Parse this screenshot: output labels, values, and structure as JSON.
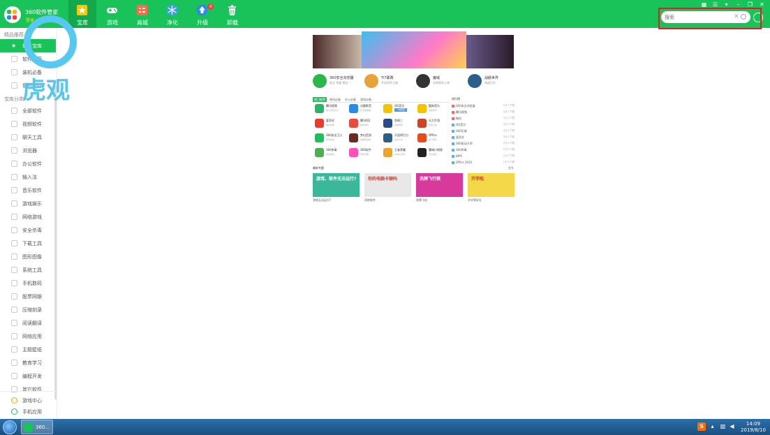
{
  "app": {
    "title": "360软件管家",
    "subtitle": "登录"
  },
  "nav": [
    {
      "label": "宝库",
      "icon": "star-icon"
    },
    {
      "label": "游戏",
      "icon": "gamepad-icon"
    },
    {
      "label": "商城",
      "icon": "store-icon"
    },
    {
      "label": "净化",
      "icon": "snowflake-icon"
    },
    {
      "label": "升级",
      "icon": "upgrade-icon",
      "badge": "4"
    },
    {
      "label": "卸载",
      "icon": "trash-icon"
    }
  ],
  "window_controls": {
    "skin": "▦",
    "menu": "☰",
    "dropdown": "▾",
    "minimize": "–",
    "restore": "❐",
    "close": "✕"
  },
  "search": {
    "placeholder": "搜索",
    "clear": "✕"
  },
  "sidebar": {
    "section_featured": "精品推荐",
    "featured_items": [
      {
        "label": "软件宝库"
      },
      {
        "label": "软件推荐"
      },
      {
        "label": "装机必备"
      },
      {
        "label": "我的软件"
      }
    ],
    "section_categories": "宝库分类",
    "categories": [
      {
        "label": "全部软件"
      },
      {
        "label": "视频软件"
      },
      {
        "label": "聊天工具"
      },
      {
        "label": "浏览器"
      },
      {
        "label": "办公软件"
      },
      {
        "label": "输入法"
      },
      {
        "label": "音乐软件"
      },
      {
        "label": "游戏娱乐"
      },
      {
        "label": "网络游戏"
      },
      {
        "label": "安全杀毒"
      },
      {
        "label": "下载工具"
      },
      {
        "label": "图形图像"
      },
      {
        "label": "系统工具"
      },
      {
        "label": "手机数码"
      },
      {
        "label": "股票网银"
      },
      {
        "label": "压缩刻录"
      },
      {
        "label": "阅读翻译"
      },
      {
        "label": "网络应用"
      },
      {
        "label": "主题壁纸"
      },
      {
        "label": "教育学习"
      },
      {
        "label": "编程开发"
      },
      {
        "label": "其它软件"
      }
    ],
    "bottom": [
      {
        "label": "游戏中心"
      },
      {
        "label": "手机应用"
      }
    ]
  },
  "watermark": {
    "text": "虎观"
  },
  "featured_apps": [
    {
      "name": "360安全浏览器",
      "desc": "安全 快速 稳定",
      "color": "#2cb74b"
    },
    {
      "name": "Ti7联赛",
      "desc": "开启冠军之路",
      "color": "#e8a23a"
    },
    {
      "name": "魔域",
      "desc": "全新版本上线",
      "color": "#333333"
    },
    {
      "name": "战舰世界",
      "desc": "海战巨作",
      "color": "#2b5f8a"
    }
  ],
  "tabs": [
    {
      "label": "热门推荐"
    },
    {
      "label": "装机必备"
    },
    {
      "label": "办公必备"
    },
    {
      "label": "游戏必备"
    }
  ],
  "grid_apps": [
    {
      "name": "腾讯视频",
      "desc": "热门影视大片",
      "color": "#29b36b"
    },
    {
      "name": "迅雷影音",
      "desc": "高清播放器",
      "color": "#2a8ae8"
    },
    {
      "name": "QQ音乐",
      "desc": "",
      "color": "#f5c400",
      "button": "一键安装"
    },
    {
      "name": "酷狗音乐",
      "desc": "海量音乐",
      "color": "#f5c400"
    },
    {
      "name": "爱奇艺",
      "desc": "精彩视频",
      "color": "#e83c2e"
    },
    {
      "name": "腾讯QQ",
      "desc": "即时通讯",
      "color": "#e84c3d"
    },
    {
      "name": "剑网三",
      "desc": "武侠网游",
      "color": "#2b4a8a"
    },
    {
      "name": "天刀手游",
      "desc": "新版上线",
      "color": "#c9442a"
    },
    {
      "name": "360安全卫士",
      "desc": "安全防护",
      "color": "#19c35a"
    },
    {
      "name": "梦幻西游",
      "desc": "经典回合制",
      "color": "#6a2a1e"
    },
    {
      "name": "天涯明月刀",
      "desc": "武侠大作",
      "color": "#2b5f8a"
    },
    {
      "name": "Office",
      "desc": "办公软件",
      "color": "#e84c1d"
    },
    {
      "name": "360杀毒",
      "desc": "查杀病毒",
      "color": "#4caf50"
    },
    {
      "name": "360软件",
      "desc": "软件管理",
      "color": "#ff4fb8"
    },
    {
      "name": "王者荣耀",
      "desc": "MOBA手游",
      "color": "#f0a22a"
    },
    {
      "name": "魔域口袋版",
      "desc": "西方魔幻",
      "color": "#222222"
    }
  ],
  "ranking": {
    "title": "排行榜",
    "items": [
      {
        "name": "360安全浏览器",
        "value": "5万人下载"
      },
      {
        "name": "腾讯视频",
        "value": "4万人下载"
      },
      {
        "name": "微信",
        "value": "4万人下载"
      },
      {
        "name": "QQ音乐",
        "value": "3万人下载"
      },
      {
        "name": "360压缩",
        "value": "3万人下载"
      },
      {
        "name": "爱奇艺",
        "value": "3万人下载"
      },
      {
        "name": "360驱动大师",
        "value": "2万人下载"
      },
      {
        "name": "360杀毒",
        "value": "2万人下载"
      },
      {
        "name": "WPS",
        "value": "2万人下载"
      },
      {
        "name": "Office 2010",
        "value": "2万人下载"
      }
    ]
  },
  "topics": {
    "title": "最新专题",
    "more": "更多",
    "items": [
      {
        "caption": "游戏无法运行?",
        "banner": "游戏、软件无法运行?",
        "color": "#3bb89a"
      },
      {
        "caption": "消除软件",
        "banner": "你的电脑卡顿吗",
        "color": "#e8e8e8"
      },
      {
        "caption": "洗牌飞机",
        "banner": "洗牌飞行棋",
        "color": "#d83a9b"
      },
      {
        "caption": "开学季好礼",
        "banner": "开学啦",
        "color": "#f5d84a"
      }
    ]
  },
  "taskbar": {
    "task_label": "360...",
    "clock_time": "14:09",
    "clock_date": "2019/8/10",
    "ime": "S"
  }
}
